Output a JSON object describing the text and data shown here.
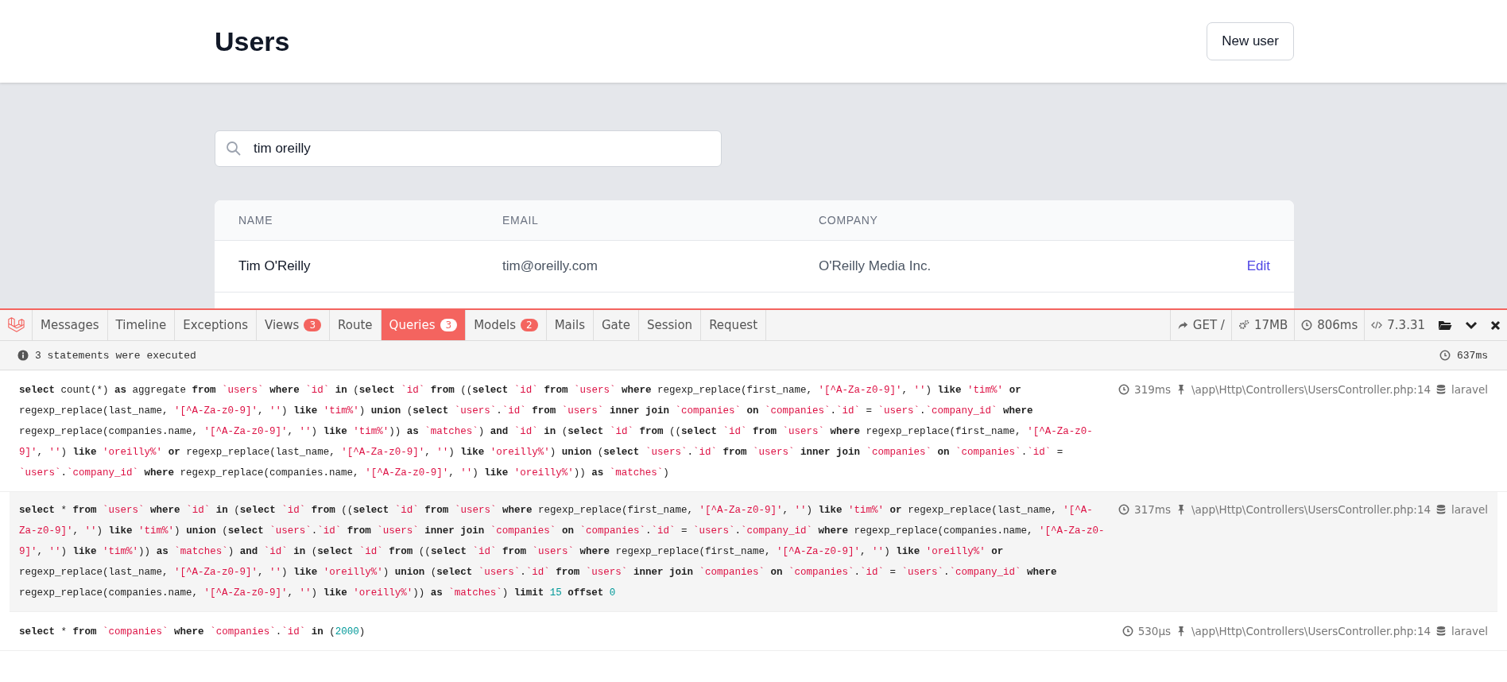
{
  "header": {
    "title": "Users",
    "new_button": "New user"
  },
  "search": {
    "value": "tim oreilly"
  },
  "table": {
    "columns": [
      "NAME",
      "EMAIL",
      "COMPANY"
    ],
    "rows": [
      {
        "name": "Tim O'Reilly",
        "email": "tim@oreilly.com",
        "company": "O'Reilly Media Inc.",
        "action": "Edit"
      }
    ]
  },
  "debugbar": {
    "tabs": [
      {
        "label": "Messages",
        "selected": false
      },
      {
        "label": "Timeline",
        "selected": false
      },
      {
        "label": "Exceptions",
        "selected": false
      },
      {
        "label": "Views",
        "badge": "3",
        "selected": false
      },
      {
        "label": "Route",
        "selected": false
      },
      {
        "label": "Queries",
        "badge": "3",
        "selected": true
      },
      {
        "label": "Models",
        "badge": "2",
        "selected": false
      },
      {
        "label": "Mails",
        "selected": false
      },
      {
        "label": "Gate",
        "selected": false
      },
      {
        "label": "Session",
        "selected": false
      },
      {
        "label": "Request",
        "selected": false
      }
    ],
    "indicators": [
      {
        "kind": "method",
        "text": "GET /"
      },
      {
        "kind": "memory",
        "text": "17MB"
      },
      {
        "kind": "time",
        "text": "806ms"
      },
      {
        "kind": "version",
        "text": "7.3.31"
      }
    ],
    "status": {
      "text": "3 statements were executed",
      "duration": "637ms"
    },
    "queries": [
      {
        "sql": "**select** count(*) **as** aggregate **from** `users` **where** `id` **in** (**select** `id` **from** ((**select** `id` **from** `users` **where** regexp_replace(first_name, '[^A-Za-z0-9]', '') **like** 'tim%' **or** regexp_replace(last_name, '[^A-Za-z0-9]', '') **like** 'tim%') **union** (**select** `users`.`id` **from** `users` **inner join** `companies` **on** `companies`.`id` = `users`.`company_id` **where** regexp_replace(companies.name, '[^A-Za-z0-9]', '') **like** 'tim%')) **as** `matches`) **and** `id` **in** (**select** `id` **from** ((**select** `id` **from** `users` **where** regexp_replace(first_name, '[^A-Za-z0-9]', '') **like** 'oreilly%' **or** regexp_replace(last_name, '[^A-Za-z0-9]', '') **like** 'oreilly%') **union** (**select** `users`.`id` **from** `users` **inner join** `companies` **on** `companies`.`id` = `users`.`company_id` **where** regexp_replace(companies.name, '[^A-Za-z0-9]', '') **like** 'oreilly%')) **as** `matches`)",
        "duration": "319ms",
        "source": "\\app\\Http\\Controllers\\UsersController.php:14",
        "connection": "laravel"
      },
      {
        "sql": "**select** * **from** `users` **where** `id` **in** (**select** `id` **from** ((**select** `id` **from** `users` **where** regexp_replace(first_name, '[^A-Za-z0-9]', '') **like** 'tim%' **or** regexp_replace(last_name, '[^A-Za-z0-9]', '') **like** 'tim%') **union** (**select** `users`.`id` **from** `users` **inner join** `companies` **on** `companies`.`id` = `users`.`company_id` **where** regexp_replace(companies.name, '[^A-Za-z0-9]', '') **like** 'tim%')) **as** `matches`) **and** `id` **in** (**select** `id` **from** ((**select** `id` **from** `users` **where** regexp_replace(first_name, '[^A-Za-z0-9]', '') **like** 'oreilly%' **or** regexp_replace(last_name, '[^A-Za-z0-9]', '') **like** 'oreilly%') **union** (**select** `users`.`id` **from** `users` **inner join** `companies` **on** `companies`.`id` = `users`.`company_id` **where** regexp_replace(companies.name, '[^A-Za-z0-9]', '') **like** 'oreilly%')) **as** `matches`) **limit** 15 **offset** 0",
        "duration": "317ms",
        "source": "\\app\\Http\\Controllers\\UsersController.php:14",
        "connection": "laravel"
      },
      {
        "sql": "**select** * **from** `companies` **where** `companies`.`id` **in** (2000)",
        "duration": "530μs",
        "source": "\\app\\Http\\Controllers\\UsersController.php:14",
        "connection": "laravel"
      }
    ]
  }
}
